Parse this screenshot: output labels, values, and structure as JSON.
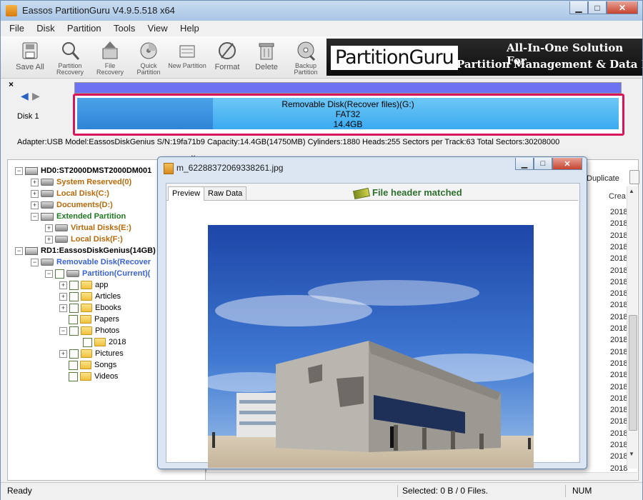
{
  "window": {
    "title": "Eassos PartitionGuru V4.9.5.518 x64"
  },
  "menu": [
    "File",
    "Disk",
    "Partition",
    "Tools",
    "View",
    "Help"
  ],
  "toolbar": [
    {
      "label": "Save All",
      "icon": "save-icon",
      "big": true
    },
    {
      "label": "Partition Recovery",
      "icon": "magnifier-icon"
    },
    {
      "label": "File Recovery",
      "icon": "file-recovery-icon"
    },
    {
      "label": "Quick Partition",
      "icon": "quick-partition-icon"
    },
    {
      "label": "New Partition",
      "icon": "new-partition-icon"
    },
    {
      "label": "Format",
      "icon": "format-icon",
      "big": true
    },
    {
      "label": "Delete",
      "icon": "trash-icon",
      "big": true
    },
    {
      "label": "Backup Partition",
      "icon": "backup-icon"
    }
  ],
  "banner": {
    "logo": "PartitionGuru",
    "tagline1": "All-In-One Solution For",
    "tagline2": "Partition Management & Data Re"
  },
  "diskmap": {
    "disk_label": "Disk  1",
    "partition_name": "Removable Disk(Recover files)(G:)",
    "fs": "FAT32",
    "size": "14.4GB",
    "info": "Adapter:USB  Model:EassosDiskGenius  S/N:19fa71b9  Capacity:14.4GB(14750MB)  Cylinders:1880  Heads:255  Sectors per Track:63  Total Sectors:30208000"
  },
  "tree": [
    {
      "label": "HD0:ST2000DMST2000DM001",
      "style": "bold",
      "type": "hdd",
      "exp": "-"
    },
    {
      "label": "System Reserved(0)",
      "style": "orange",
      "type": "vol",
      "exp": "+"
    },
    {
      "label": "Local Disk(C:)",
      "style": "orange",
      "type": "vol",
      "exp": "+"
    },
    {
      "label": "Documents(D:)",
      "style": "orange",
      "type": "vol",
      "exp": "+"
    },
    {
      "label": "Extended Partition",
      "style": "green",
      "type": "hdd",
      "exp": "-"
    },
    {
      "label": "Virtual Disks(E:)",
      "style": "orange",
      "type": "vol",
      "exp": "+"
    },
    {
      "label": "Local Disk(F:)",
      "style": "orange",
      "type": "vol",
      "exp": "+"
    },
    {
      "label": "RD1:EassosDiskGenius(14GB)",
      "style": "bold",
      "type": "hdd",
      "exp": "-"
    },
    {
      "label": "Removable Disk(Recover",
      "style": "blue",
      "type": "vol",
      "exp": "-"
    },
    {
      "label": "Partition(Current)(",
      "style": "blue",
      "type": "vol",
      "exp": "-",
      "chk": true
    },
    {
      "label": "app",
      "type": "folder",
      "exp": "+",
      "chk": true
    },
    {
      "label": "Articles",
      "type": "folder",
      "exp": "+",
      "chk": true
    },
    {
      "label": "Ebooks",
      "type": "folder",
      "exp": "+",
      "chk": true
    },
    {
      "label": "Papers",
      "type": "folder",
      "exp": "",
      "chk": true
    },
    {
      "label": "Photos",
      "type": "folder",
      "exp": "-",
      "chk": true
    },
    {
      "label": "2018",
      "type": "folder",
      "exp": "",
      "chk": true
    },
    {
      "label": "Pictures",
      "type": "folder",
      "exp": "+",
      "chk": true
    },
    {
      "label": "Songs",
      "type": "folder",
      "exp": "",
      "chk": true
    },
    {
      "label": "Videos",
      "type": "folder",
      "exp": "",
      "chk": true
    }
  ],
  "right_panel": {
    "duplicate_label": "Duplicate",
    "column_header": "Crea",
    "years": [
      "2018",
      "2018",
      "2018",
      "2018",
      "2018",
      "2018",
      "2018",
      "2018",
      "2018",
      "2018",
      "2018",
      "2018",
      "2018",
      "2018",
      "2018",
      "2018",
      "2018",
      "2018",
      "2018",
      "2018",
      "2018",
      "2018",
      "2018"
    ]
  },
  "dialog": {
    "title": "m_62288372069338261.jpg",
    "tab_preview": "Preview",
    "tab_raw": "Raw Data",
    "status": "File header matched"
  },
  "status": {
    "left": "Ready",
    "selected": "Selected: 0 B / 0 Files.",
    "num": "NUM"
  }
}
